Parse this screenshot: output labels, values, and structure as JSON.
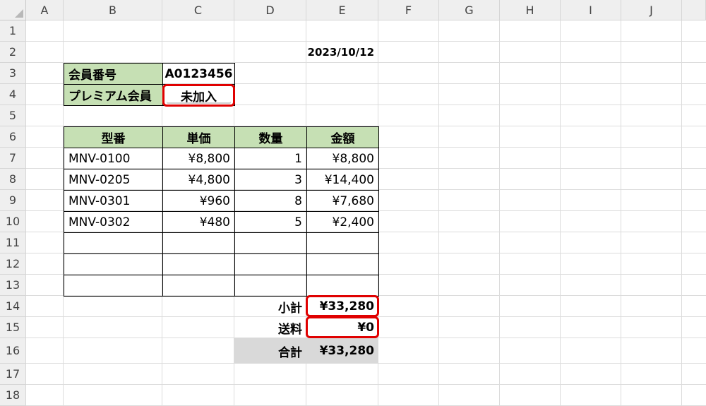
{
  "columns": [
    "A",
    "B",
    "C",
    "D",
    "E",
    "F",
    "G",
    "H",
    "I",
    "J"
  ],
  "rows": [
    "1",
    "2",
    "3",
    "4",
    "5",
    "6",
    "7",
    "8",
    "9",
    "10",
    "11",
    "12",
    "13",
    "14",
    "15",
    "16",
    "17",
    "18"
  ],
  "date": "2023/10/12",
  "member": {
    "id_label": "会員番号",
    "id_value": "A0123456",
    "premium_label": "プレミアム会員",
    "premium_value": "未加入"
  },
  "table": {
    "headers": [
      "型番",
      "単価",
      "数量",
      "金額"
    ],
    "rows": [
      {
        "model": "MNV-0100",
        "price": "¥8,800",
        "qty": "1",
        "amount": "¥8,800"
      },
      {
        "model": "MNV-0205",
        "price": "¥4,800",
        "qty": "3",
        "amount": "¥14,400"
      },
      {
        "model": "MNV-0301",
        "price": "¥960",
        "qty": "8",
        "amount": "¥7,680"
      },
      {
        "model": "MNV-0302",
        "price": "¥480",
        "qty": "5",
        "amount": "¥2,400"
      }
    ]
  },
  "totals": {
    "subtotal_label": "小計",
    "subtotal_value": "¥33,280",
    "shipping_label": "送料",
    "shipping_value": "¥0",
    "total_label": "合計",
    "total_value": "¥33,280"
  },
  "colors": {
    "header_fill": "#c6e0b4",
    "total_fill": "#d9d9d9",
    "highlight": "#e00000"
  }
}
